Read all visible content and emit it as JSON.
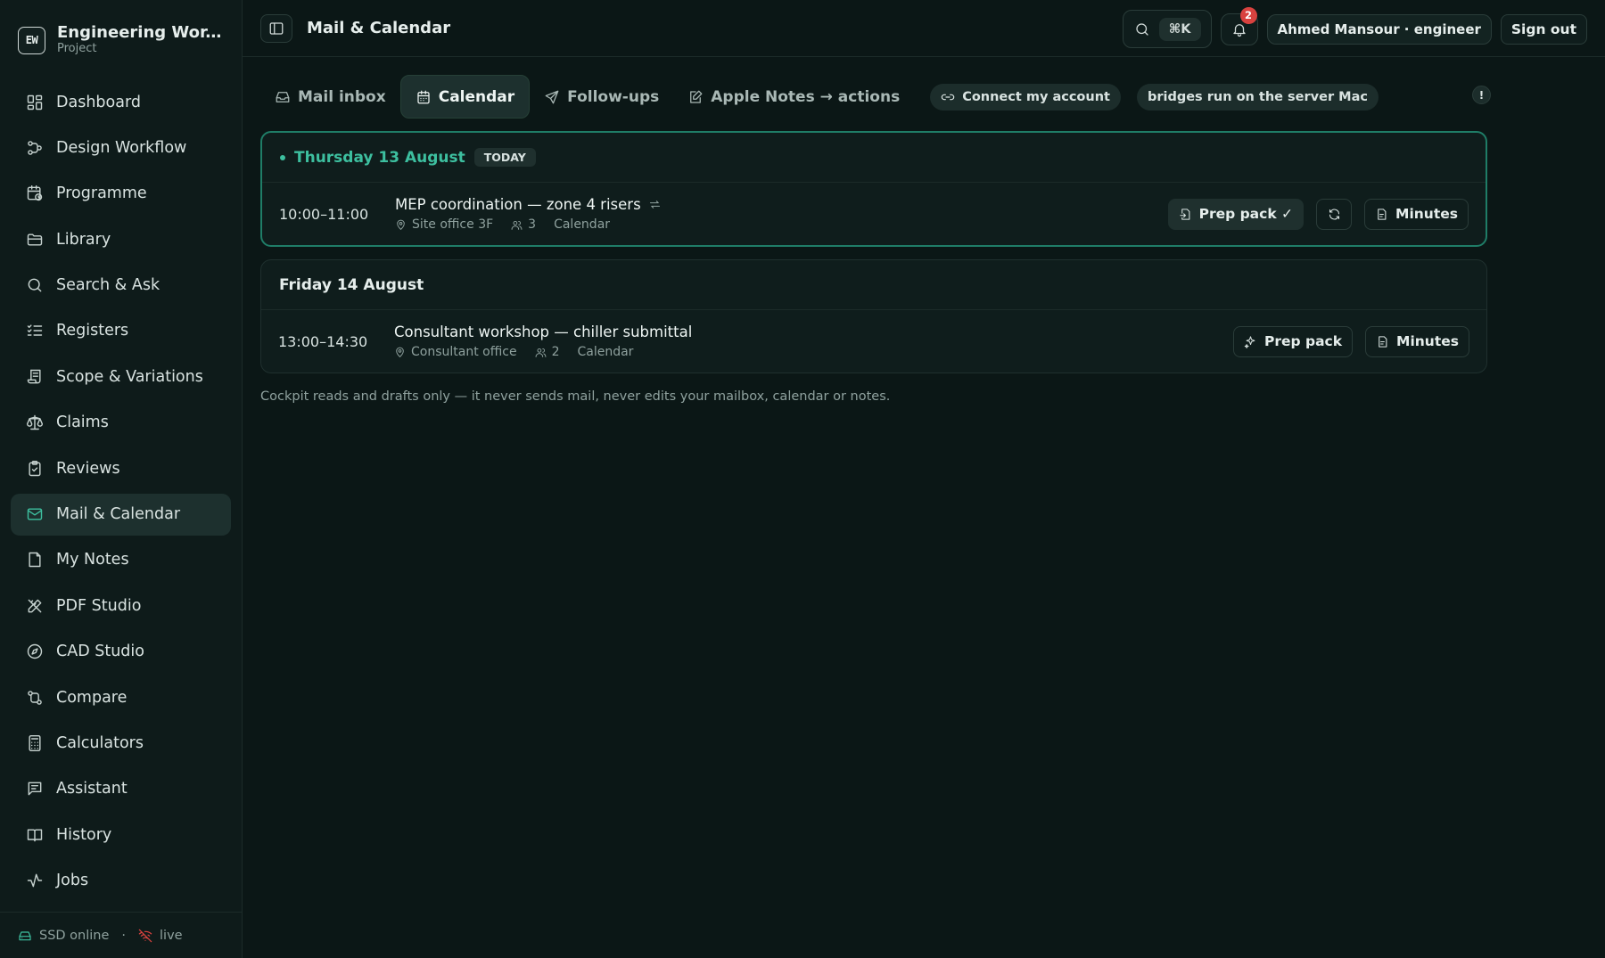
{
  "brand": {
    "logo": "EW",
    "title": "Engineering Wor...",
    "subtitle": "Project"
  },
  "nav": [
    {
      "label": "Dashboard",
      "icon": "dashboard-icon"
    },
    {
      "label": "Design Workflow",
      "icon": "workflow-icon"
    },
    {
      "label": "Programme",
      "icon": "calendar-clock-icon"
    },
    {
      "label": "Library",
      "icon": "folder-icon"
    },
    {
      "label": "Search & Ask",
      "icon": "search-icon"
    },
    {
      "label": "Registers",
      "icon": "checklist-icon"
    },
    {
      "label": "Scope & Variations",
      "icon": "scroll-icon"
    },
    {
      "label": "Claims",
      "icon": "scale-icon"
    },
    {
      "label": "Reviews",
      "icon": "clipboard-check-icon"
    },
    {
      "label": "Mail & Calendar",
      "icon": "mail-icon",
      "active": true
    },
    {
      "label": "My Notes",
      "icon": "note-icon"
    },
    {
      "label": "PDF Studio",
      "icon": "pen-ruler-icon"
    },
    {
      "label": "CAD Studio",
      "icon": "compass-icon"
    },
    {
      "label": "Compare",
      "icon": "compare-icon"
    },
    {
      "label": "Calculators",
      "icon": "calculator-icon"
    },
    {
      "label": "Assistant",
      "icon": "chat-icon"
    },
    {
      "label": "History",
      "icon": "book-icon"
    },
    {
      "label": "Jobs",
      "icon": "activity-icon"
    }
  ],
  "footer": {
    "storage": "SSD online",
    "separator": "·",
    "live": "live"
  },
  "topbar": {
    "title": "Mail & Calendar",
    "shortcut": "⌘K",
    "notifications": "2",
    "user": "Ahmed Mansour · engineer",
    "signout": "Sign out"
  },
  "tabs": [
    {
      "label": "Mail inbox",
      "icon": "inbox-icon"
    },
    {
      "label": "Calendar",
      "icon": "calendar-icon",
      "active": true
    },
    {
      "label": "Follow-ups",
      "icon": "send-icon"
    },
    {
      "label": "Apple Notes → actions",
      "icon": "note-edit-icon"
    }
  ],
  "pills": {
    "connect": "Connect my account",
    "bridges": "bridges run on the server Mac",
    "alert": "!"
  },
  "days": [
    {
      "label": "Thursday 13 August",
      "today_tag": "TODAY",
      "events": [
        {
          "time": "10:00–11:00",
          "title": "MEP coordination — zone 4 risers",
          "location": "Site office 3F",
          "attendees": "3",
          "source": "Calendar",
          "prep_label": "Prep pack ✓",
          "minutes_label": "Minutes"
        }
      ]
    },
    {
      "label": "Friday 14 August",
      "events": [
        {
          "time": "13:00–14:30",
          "title": "Consultant workshop — chiller submittal",
          "location": "Consultant office",
          "attendees": "2",
          "source": "Calendar",
          "prep_label": "Prep pack",
          "minutes_label": "Minutes"
        }
      ]
    }
  ],
  "note": "Cockpit reads and drafts only — it never sends mail, never edits your mailbox, calendar or notes.",
  "colors": {
    "accent": "#3dbf9f",
    "background": "#0b1716",
    "badge": "#d9423f"
  }
}
